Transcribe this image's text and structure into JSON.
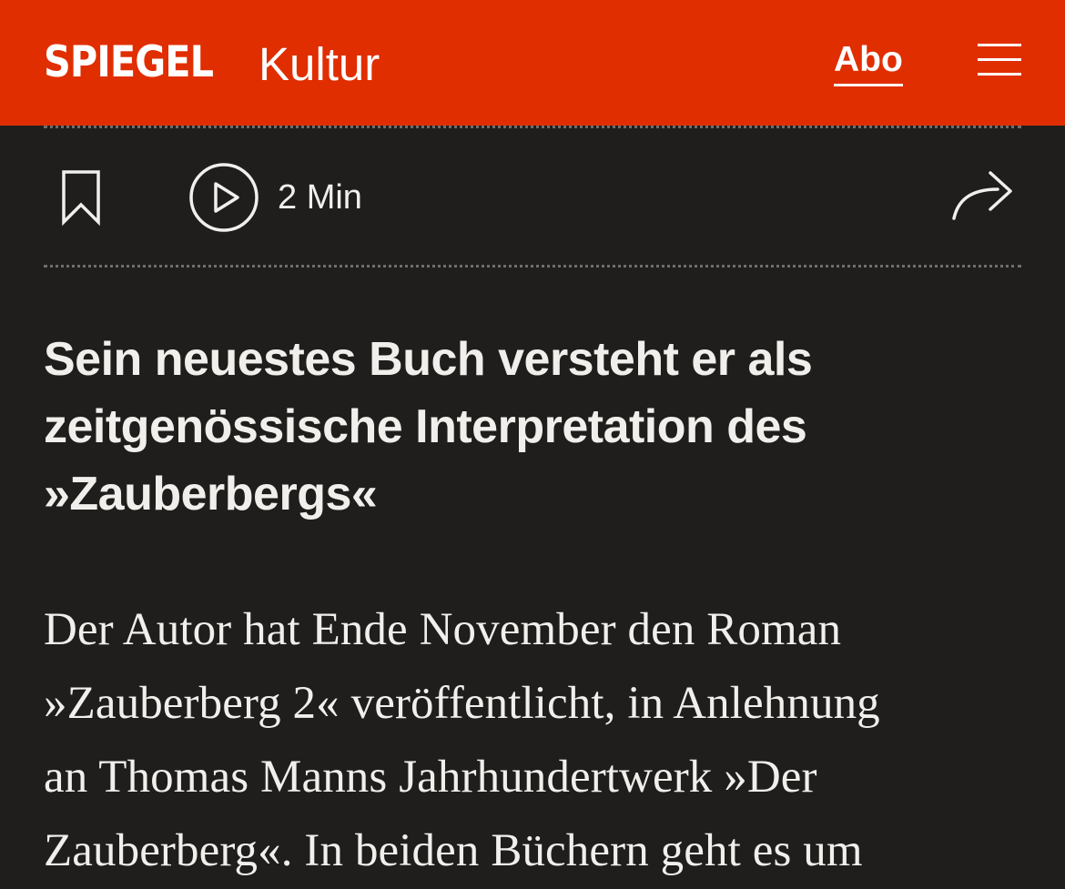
{
  "header": {
    "brand": "SPIEGEL",
    "section": "Kultur",
    "abo_label": "Abo",
    "menu_icon": "hamburger-menu-icon",
    "background_color": "#e02e00"
  },
  "toolbar": {
    "bookmark_icon": "bookmark-icon",
    "play_icon": "play-circle-icon",
    "duration": "2 Min",
    "share_icon": "share-icon"
  },
  "article": {
    "headline_lines": [
      "Sein neuestes Buch versteht er als",
      "zeitgenössische Interpretation des",
      "»Zauberbergs«"
    ],
    "body_lines": [
      "Der Autor hat Ende November den Roman",
      "»Zauberberg 2« veröffentlicht, in Anlehnung",
      "an Thomas Manns Jahrhundertwerk »Der",
      "Zauberberg«. In beiden Büchern geht es um"
    ]
  },
  "colors": {
    "background": "#1f1e1c",
    "text": "#f1efec",
    "accent": "#e02e00"
  }
}
